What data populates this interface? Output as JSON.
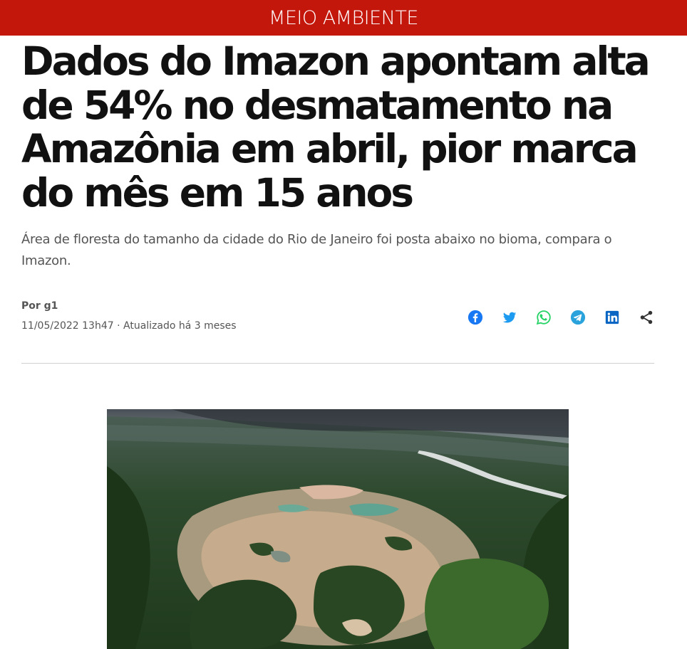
{
  "section": {
    "label": "MEIO AMBIENTE"
  },
  "article": {
    "headline": "Dados do Imazon apontam alta de 54% no desmatamento na Amazônia em abril, pior marca do mês em 15 anos",
    "subtitle": "Área de floresta do tamanho da cidade do Rio de Janeiro foi posta abaixo no bioma, compara o Imazon.",
    "author": "Por g1",
    "dateline": "11/05/2022 13h47 · Atualizado há 3 meses"
  },
  "share": {
    "buttons": [
      {
        "icon": "facebook-icon",
        "color": "#1877f2"
      },
      {
        "icon": "twitter-icon",
        "color": "#1d9bf0"
      },
      {
        "icon": "whatsapp-icon",
        "color": "#25d366"
      },
      {
        "icon": "telegram-icon",
        "color": "#2aa3dd"
      },
      {
        "icon": "linkedin-icon",
        "color": "#0a66c2"
      },
      {
        "icon": "share-icon",
        "color": "#333333"
      }
    ]
  },
  "theme": {
    "brand": "#c4170c",
    "text": "#111111",
    "muted": "#555555",
    "divider": "#d0d0d0"
  }
}
